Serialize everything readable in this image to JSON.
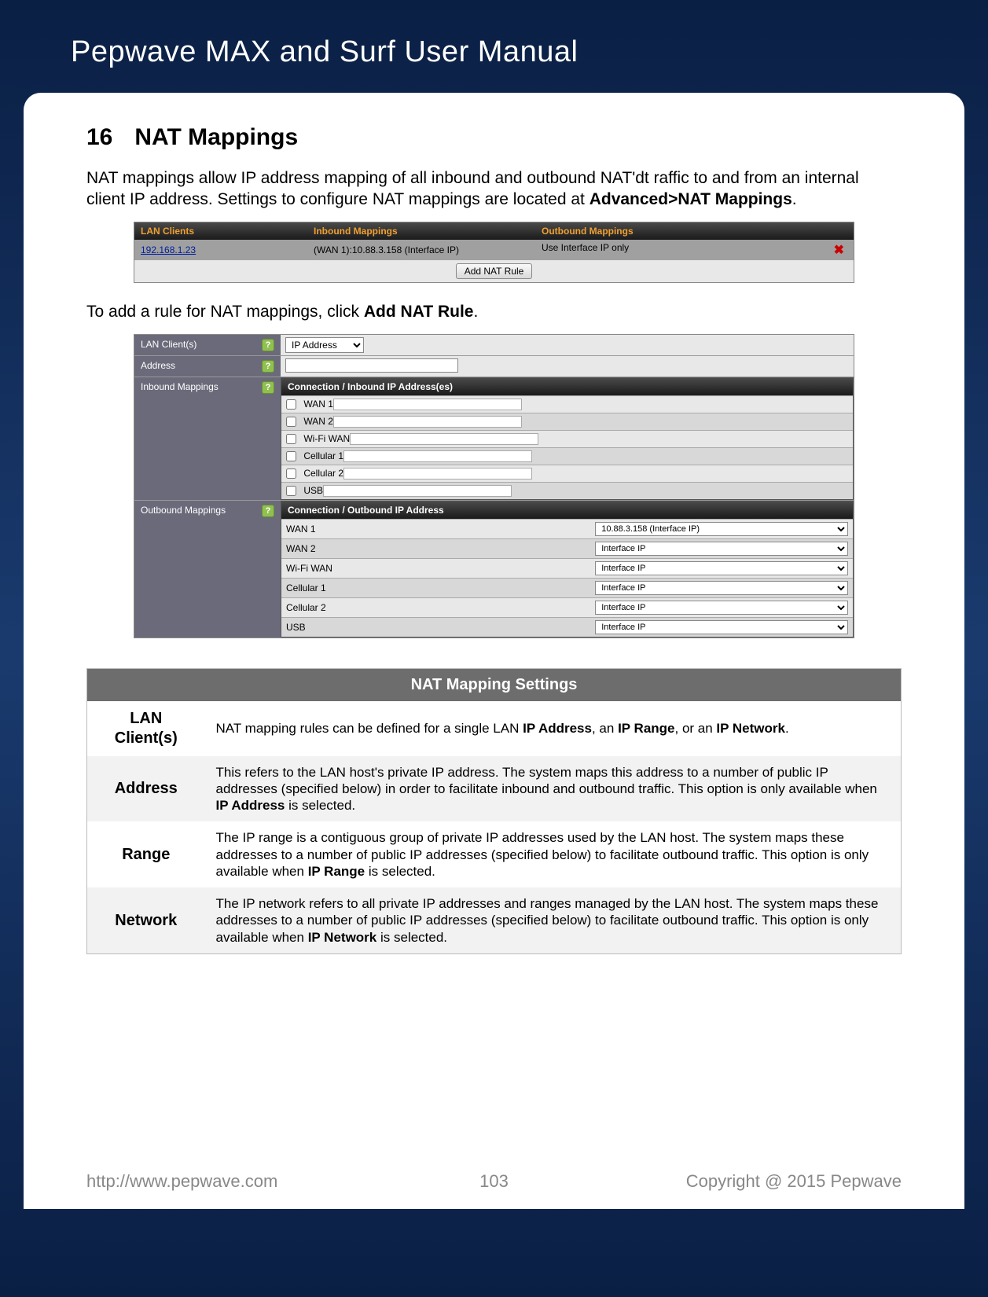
{
  "header": {
    "title": "Pepwave MAX and Surf User Manual"
  },
  "section": {
    "number": "16",
    "title": "NAT Mappings"
  },
  "intro_prefix": "NAT mappings allow IP address mapping of all inbound and outbound NAT'dt raffic to and from an internal client IP address. Settings to configure NAT mappings are located at ",
  "intro_bold": "Advanced>NAT Mappings",
  "intro_suffix": ".",
  "ss1": {
    "headers": {
      "c1": "LAN Clients",
      "c2": "Inbound Mappings",
      "c3": "Outbound Mappings"
    },
    "row": {
      "client": "192.168.1.23",
      "inbound": "(WAN 1):10.88.3.158 (Interface IP)",
      "outbound": "Use Interface IP only"
    },
    "add_button": "Add NAT Rule"
  },
  "mid_prefix": "To add a rule for NAT mappings, click ",
  "mid_bold": "Add NAT Rule",
  "mid_suffix": ".",
  "ss2": {
    "lan_clients_label": "LAN Client(s)",
    "lan_clients_value": "IP Address",
    "address_label": "Address",
    "inbound_label": "Inbound Mappings",
    "inbound_header": "Connection / Inbound IP Address(es)",
    "inbound_items": [
      "WAN 1",
      "WAN 2",
      "Wi-Fi WAN",
      "Cellular 1",
      "Cellular 2",
      "USB"
    ],
    "outbound_label": "Outbound Mappings",
    "outbound_header": "Connection / Outbound IP Address",
    "outbound_rows": [
      {
        "name": "WAN 1",
        "value": "10.88.3.158 (Interface IP)"
      },
      {
        "name": "WAN 2",
        "value": "Interface IP"
      },
      {
        "name": "Wi-Fi WAN",
        "value": "Interface IP"
      },
      {
        "name": "Cellular 1",
        "value": "Interface IP"
      },
      {
        "name": "Cellular 2",
        "value": "Interface IP"
      },
      {
        "name": "USB",
        "value": "Interface IP"
      }
    ]
  },
  "settings": {
    "title": "NAT Mapping Settings",
    "rows": [
      {
        "name": "LAN Client(s)",
        "prefix": "NAT mapping rules can be defined for a single LAN ",
        "b1": "IP Address",
        "mid1": ", an ",
        "b2": "IP Range",
        "mid2": ", or an ",
        "b3": "IP Network",
        "suffix": "."
      },
      {
        "name": "Address",
        "prefix": "This refers to the LAN host's private IP address. The system maps this address to a number of public IP addresses (specified below) in order to facilitate inbound and outbound traffic. This option is only available when ",
        "b1": "IP Address",
        "suffix": " is selected."
      },
      {
        "name": "Range",
        "prefix": "The IP range is a contiguous group of private IP addresses used by the LAN host. The system maps these addresses to a number of public IP addresses (specified below) to facilitate outbound traffic. This option is only available when ",
        "b1": "IP Range",
        "suffix": " is selected."
      },
      {
        "name": "Network",
        "prefix": "The IP network refers to all private IP addresses and ranges managed by the LAN host. The system maps these addresses to a number of public IP addresses (specified below) to facilitate outbound traffic. This option is only available when ",
        "b1": "IP Network",
        "suffix": " is selected."
      }
    ]
  },
  "footer": {
    "url": "http://www.pepwave.com",
    "page": "103",
    "copyright": "Copyright @ 2015 Pepwave"
  }
}
